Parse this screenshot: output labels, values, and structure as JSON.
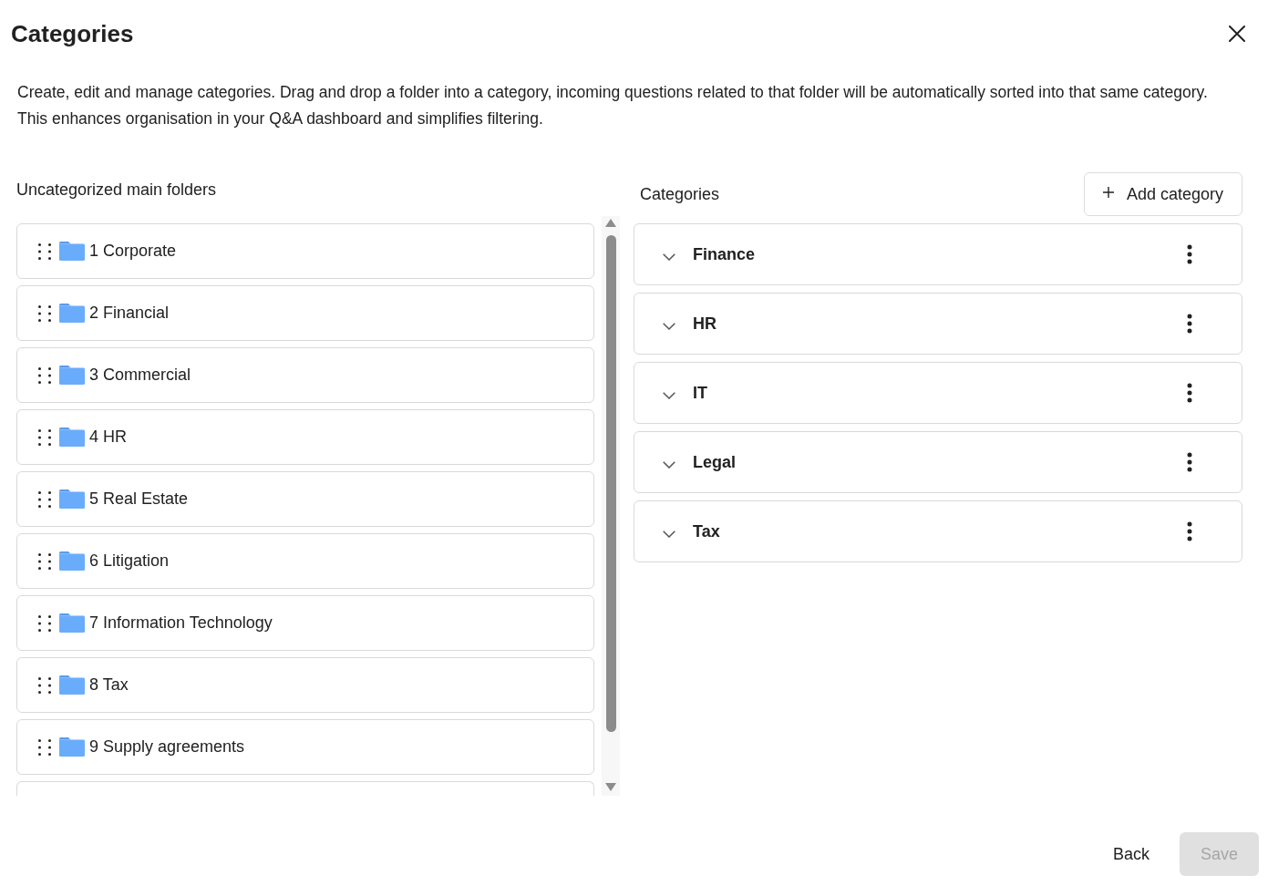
{
  "dialog": {
    "title": "Categories",
    "description": "Create, edit and manage categories. Drag and drop a folder into a category, incoming questions related to that folder will be automatically sorted into that same category. This enhances organisation in your Q&A dashboard and simplifies filtering."
  },
  "folders_panel": {
    "heading": "Uncategorized main folders",
    "folders": [
      {
        "label": "1 Corporate"
      },
      {
        "label": "2 Financial"
      },
      {
        "label": "3 Commercial"
      },
      {
        "label": "4 HR"
      },
      {
        "label": "5 Real Estate"
      },
      {
        "label": "6 Litigation"
      },
      {
        "label": "7 Information Technology"
      },
      {
        "label": "8 Tax"
      },
      {
        "label": "9 Supply agreements"
      }
    ]
  },
  "categories_panel": {
    "heading": "Categories",
    "add_button": "Add category",
    "categories": [
      {
        "name": "Finance",
        "expanded": false
      },
      {
        "name": "HR",
        "expanded": false
      },
      {
        "name": "IT",
        "expanded": false
      },
      {
        "name": "Legal",
        "expanded": false
      },
      {
        "name": "Tax",
        "expanded": false
      }
    ]
  },
  "footer": {
    "buttons": [
      {
        "label": "Back",
        "kind": "text",
        "disabled": false
      },
      {
        "label": "Save",
        "kind": "filled",
        "disabled": true
      }
    ]
  }
}
